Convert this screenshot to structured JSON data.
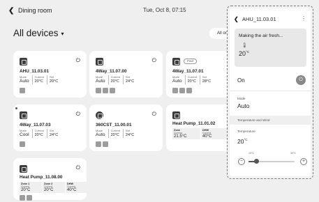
{
  "header": {
    "room": "Dining room",
    "datetime": "Tue, Oct 8, 07:15"
  },
  "page": {
    "title": "All devices",
    "all_on_label": "All on"
  },
  "devices": [
    {
      "name": "AHU_11.03.01",
      "mode_label": "Mode",
      "mode": "Auto",
      "current_label": "Current",
      "current": "20°C",
      "set_label": "Set",
      "set": "20°C"
    },
    {
      "name": "4Way_11.07.00",
      "mode_label": "Mode",
      "mode": "Auto",
      "current_label": "Current",
      "current": "20°C",
      "set_label": "Set",
      "set": "24°C"
    },
    {
      "name": "4Way_11.07.01",
      "pill": "Paid",
      "mode_label": "Mode",
      "mode": "Auto",
      "current_label": "Current",
      "current": "20°C",
      "set_label": "Set",
      "set": "28°C"
    },
    {
      "name": "4Way_11.07.03",
      "mode_label": "Mode",
      "mode": "Cool",
      "current_label": "Current",
      "current": "20°C",
      "set_label": "Set",
      "set": "24°C"
    },
    {
      "name": "360CST_11.00.01",
      "mode_label": "Mode",
      "mode": "Auto",
      "current_label": "Current",
      "current": "20°C",
      "set_label": "Set",
      "set": "24°C"
    },
    {
      "name": "Heat Pump_11.01.02",
      "zones": [
        {
          "label": "Zone",
          "sub": "Current",
          "value": "21.5°C"
        },
        {
          "label": "DHW",
          "sub": "Current",
          "value": "40°C"
        }
      ]
    },
    {
      "name": "Heat Pump_11.08.00",
      "zones": [
        {
          "label": "Zone 1",
          "sub": "Current",
          "value": "20°C"
        },
        {
          "label": "Zone 2",
          "sub": "Current",
          "value": "20°C"
        },
        {
          "label": "DHW",
          "sub": "Current",
          "value": "40°C"
        }
      ]
    }
  ],
  "panel": {
    "title": "AHU_11.03.01",
    "status_text": "Making the air fresh...",
    "status_temp": "20",
    "unit": "°C",
    "on_label": "On",
    "mode_label": "Mode",
    "mode_value": "Auto",
    "section_label": "Temperature and Wind",
    "temp_label": "Temperature",
    "temp_value": "20",
    "range_min": "10°C",
    "range_max": "30°C",
    "slider_fraction": 0.18
  },
  "icons": {
    "back": "chevron-left-icon",
    "caret": "caret-down-icon",
    "power": "power-icon",
    "more": "more-vertical-icon",
    "thermometer": "thermometer-icon"
  }
}
